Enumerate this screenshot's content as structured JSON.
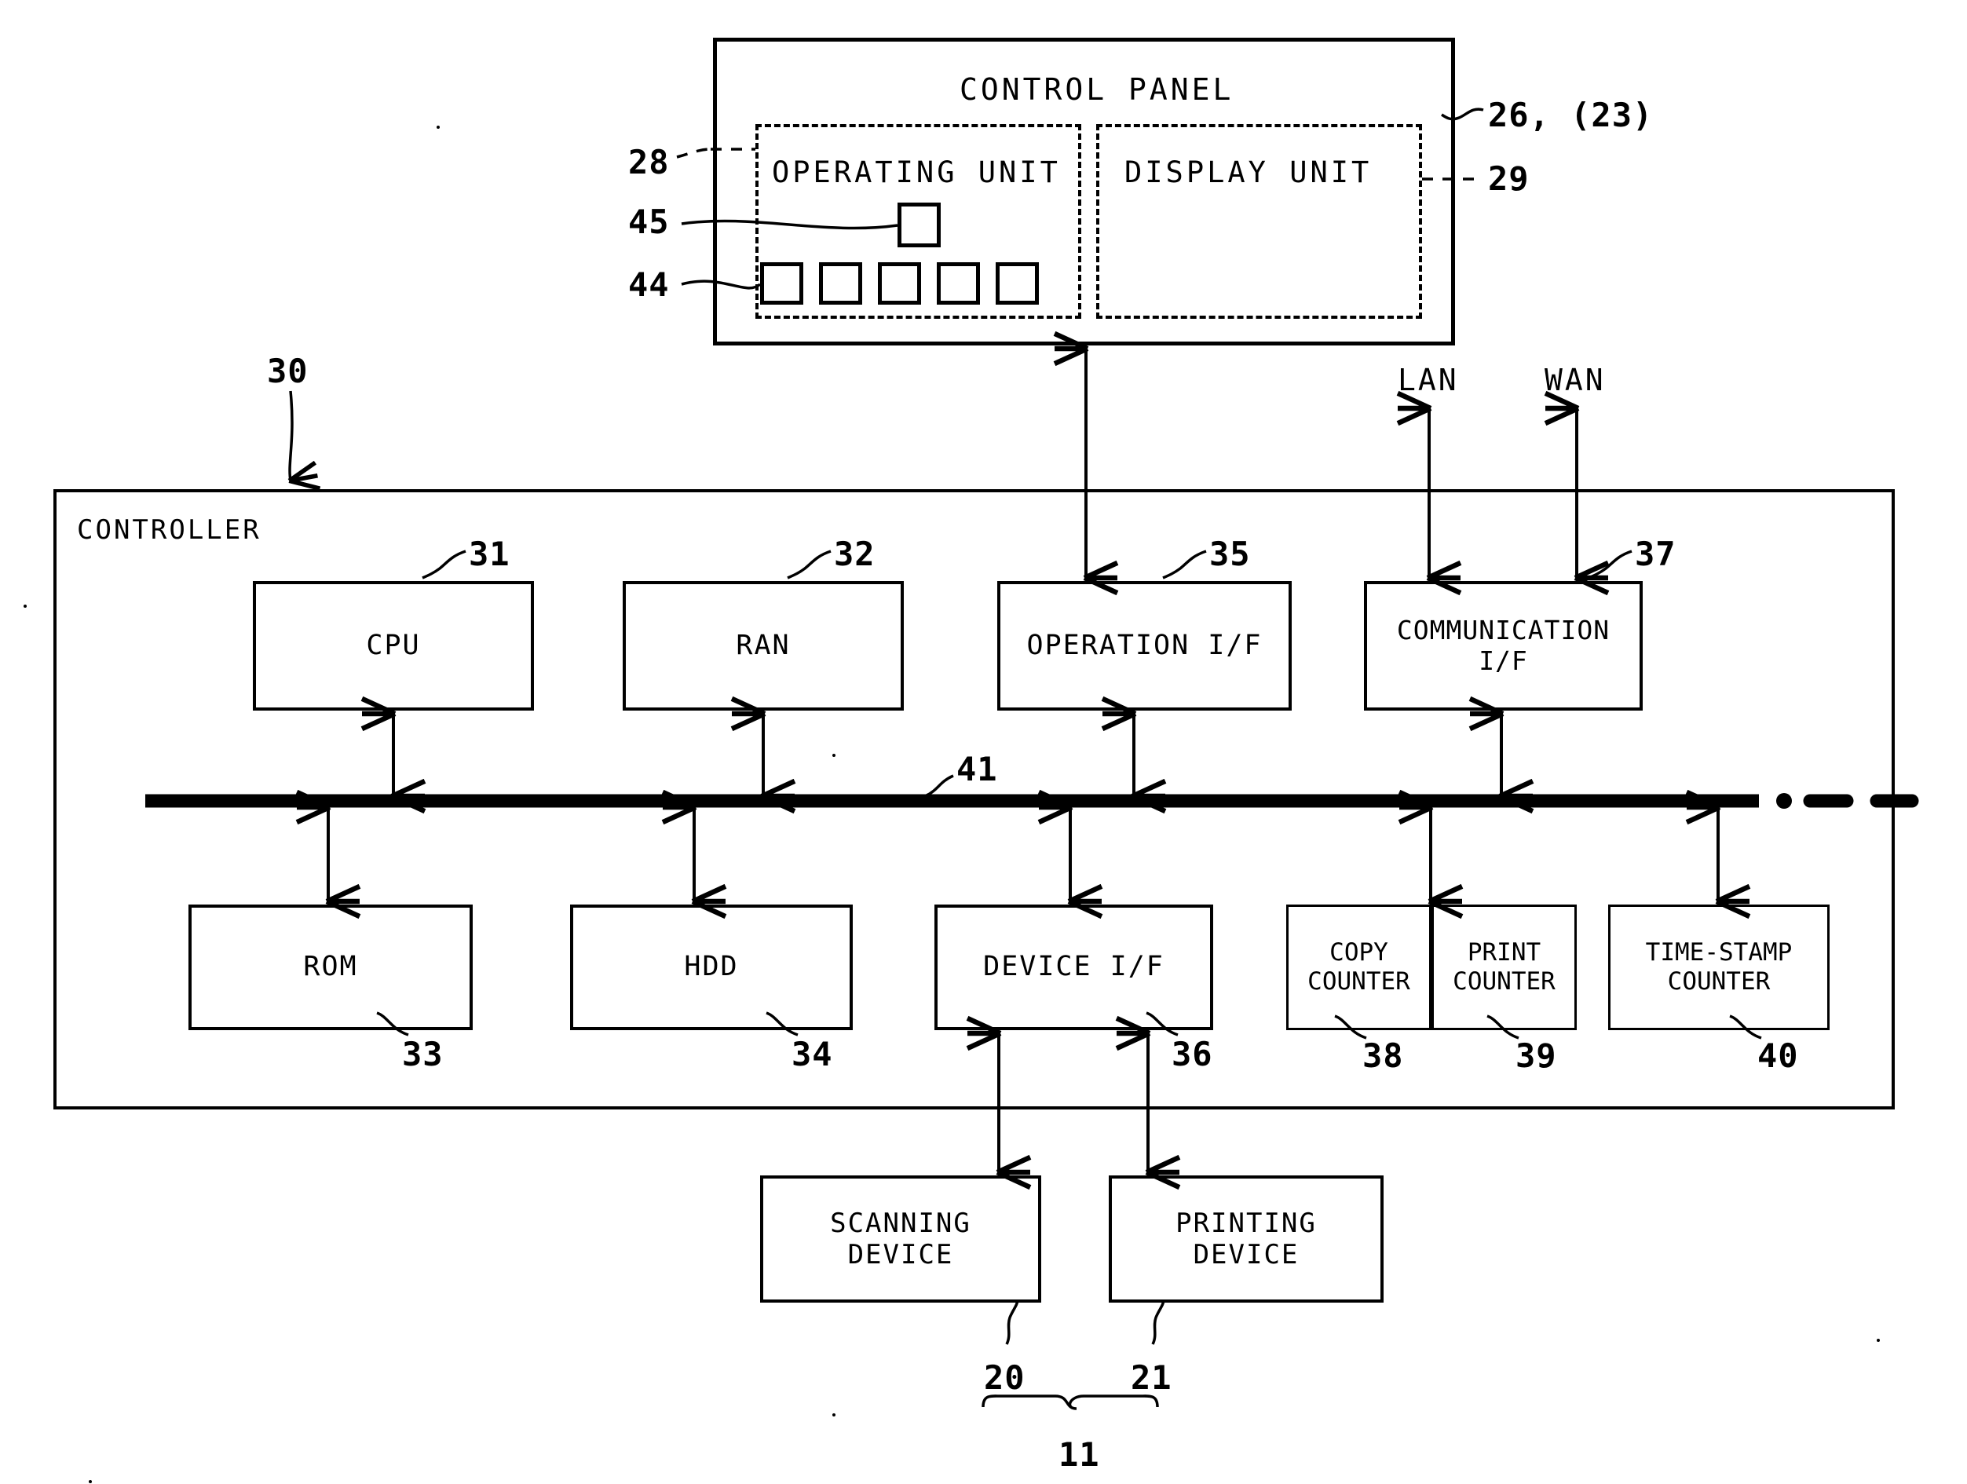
{
  "figure": {
    "kind": "patent-block-diagram",
    "control_panel": {
      "title": "CONTROL PANEL",
      "ref": "26, (23)",
      "operating_unit": {
        "title": "OPERATING UNIT",
        "ref": "28"
      },
      "display_unit": {
        "title": "DISPLAY UNIT",
        "ref": "29"
      },
      "keys": {
        "single_key_ref": "45",
        "key_row_ref": "44",
        "key_row_count": 5
      }
    },
    "controller": {
      "title": "CONTROLLER",
      "ref": "30",
      "bus_ref": "41",
      "top_row": [
        {
          "label": "CPU",
          "ref": "31"
        },
        {
          "label": "RAN",
          "ref": "32"
        },
        {
          "label": "OPERATION I/F",
          "ref": "35"
        },
        {
          "label": "COMMUNICATION\nI/F",
          "ref": "37"
        }
      ],
      "bottom_row": [
        {
          "label": "ROM",
          "ref": "33"
        },
        {
          "label": "HDD",
          "ref": "34"
        },
        {
          "label": "DEVICE I/F",
          "ref": "36"
        },
        {
          "label": "COPY\nCOUNTER",
          "ref": "38"
        },
        {
          "label": "PRINT\nCOUNTER",
          "ref": "39"
        },
        {
          "label": "TIME-STAMP\nCOUNTER",
          "ref": "40"
        }
      ]
    },
    "network": {
      "lan": "LAN",
      "wan": "WAN"
    },
    "devices": [
      {
        "label": "SCANNING\nDEVICE",
        "ref": "20"
      },
      {
        "label": "PRINTING\nDEVICE",
        "ref": "21"
      }
    ],
    "device_group_ref": "11"
  }
}
